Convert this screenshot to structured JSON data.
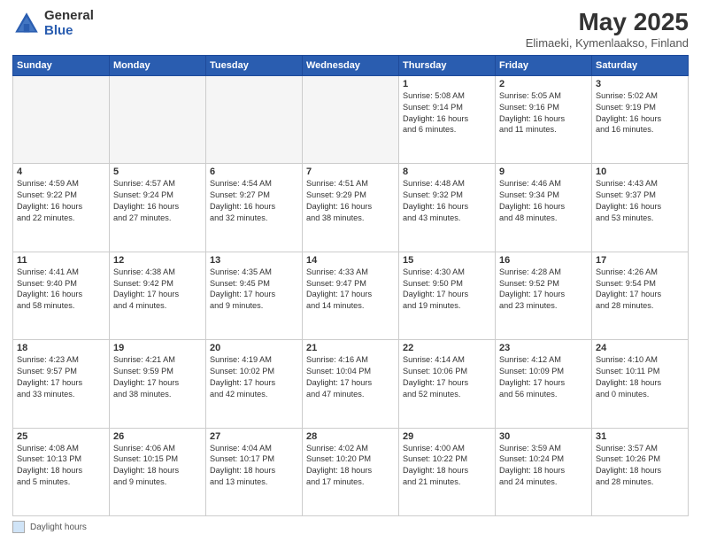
{
  "logo": {
    "general": "General",
    "blue": "Blue"
  },
  "title": "May 2025",
  "subtitle": "Elimaeki, Kymenlaakso, Finland",
  "days_of_week": [
    "Sunday",
    "Monday",
    "Tuesday",
    "Wednesday",
    "Thursday",
    "Friday",
    "Saturday"
  ],
  "footer": {
    "box_label": "Daylight hours"
  },
  "weeks": [
    [
      {
        "num": "",
        "info": ""
      },
      {
        "num": "",
        "info": ""
      },
      {
        "num": "",
        "info": ""
      },
      {
        "num": "",
        "info": ""
      },
      {
        "num": "1",
        "info": "Sunrise: 5:08 AM\nSunset: 9:14 PM\nDaylight: 16 hours\nand 6 minutes."
      },
      {
        "num": "2",
        "info": "Sunrise: 5:05 AM\nSunset: 9:16 PM\nDaylight: 16 hours\nand 11 minutes."
      },
      {
        "num": "3",
        "info": "Sunrise: 5:02 AM\nSunset: 9:19 PM\nDaylight: 16 hours\nand 16 minutes."
      }
    ],
    [
      {
        "num": "4",
        "info": "Sunrise: 4:59 AM\nSunset: 9:22 PM\nDaylight: 16 hours\nand 22 minutes."
      },
      {
        "num": "5",
        "info": "Sunrise: 4:57 AM\nSunset: 9:24 PM\nDaylight: 16 hours\nand 27 minutes."
      },
      {
        "num": "6",
        "info": "Sunrise: 4:54 AM\nSunset: 9:27 PM\nDaylight: 16 hours\nand 32 minutes."
      },
      {
        "num": "7",
        "info": "Sunrise: 4:51 AM\nSunset: 9:29 PM\nDaylight: 16 hours\nand 38 minutes."
      },
      {
        "num": "8",
        "info": "Sunrise: 4:48 AM\nSunset: 9:32 PM\nDaylight: 16 hours\nand 43 minutes."
      },
      {
        "num": "9",
        "info": "Sunrise: 4:46 AM\nSunset: 9:34 PM\nDaylight: 16 hours\nand 48 minutes."
      },
      {
        "num": "10",
        "info": "Sunrise: 4:43 AM\nSunset: 9:37 PM\nDaylight: 16 hours\nand 53 minutes."
      }
    ],
    [
      {
        "num": "11",
        "info": "Sunrise: 4:41 AM\nSunset: 9:40 PM\nDaylight: 16 hours\nand 58 minutes."
      },
      {
        "num": "12",
        "info": "Sunrise: 4:38 AM\nSunset: 9:42 PM\nDaylight: 17 hours\nand 4 minutes."
      },
      {
        "num": "13",
        "info": "Sunrise: 4:35 AM\nSunset: 9:45 PM\nDaylight: 17 hours\nand 9 minutes."
      },
      {
        "num": "14",
        "info": "Sunrise: 4:33 AM\nSunset: 9:47 PM\nDaylight: 17 hours\nand 14 minutes."
      },
      {
        "num": "15",
        "info": "Sunrise: 4:30 AM\nSunset: 9:50 PM\nDaylight: 17 hours\nand 19 minutes."
      },
      {
        "num": "16",
        "info": "Sunrise: 4:28 AM\nSunset: 9:52 PM\nDaylight: 17 hours\nand 23 minutes."
      },
      {
        "num": "17",
        "info": "Sunrise: 4:26 AM\nSunset: 9:54 PM\nDaylight: 17 hours\nand 28 minutes."
      }
    ],
    [
      {
        "num": "18",
        "info": "Sunrise: 4:23 AM\nSunset: 9:57 PM\nDaylight: 17 hours\nand 33 minutes."
      },
      {
        "num": "19",
        "info": "Sunrise: 4:21 AM\nSunset: 9:59 PM\nDaylight: 17 hours\nand 38 minutes."
      },
      {
        "num": "20",
        "info": "Sunrise: 4:19 AM\nSunset: 10:02 PM\nDaylight: 17 hours\nand 42 minutes."
      },
      {
        "num": "21",
        "info": "Sunrise: 4:16 AM\nSunset: 10:04 PM\nDaylight: 17 hours\nand 47 minutes."
      },
      {
        "num": "22",
        "info": "Sunrise: 4:14 AM\nSunset: 10:06 PM\nDaylight: 17 hours\nand 52 minutes."
      },
      {
        "num": "23",
        "info": "Sunrise: 4:12 AM\nSunset: 10:09 PM\nDaylight: 17 hours\nand 56 minutes."
      },
      {
        "num": "24",
        "info": "Sunrise: 4:10 AM\nSunset: 10:11 PM\nDaylight: 18 hours\nand 0 minutes."
      }
    ],
    [
      {
        "num": "25",
        "info": "Sunrise: 4:08 AM\nSunset: 10:13 PM\nDaylight: 18 hours\nand 5 minutes."
      },
      {
        "num": "26",
        "info": "Sunrise: 4:06 AM\nSunset: 10:15 PM\nDaylight: 18 hours\nand 9 minutes."
      },
      {
        "num": "27",
        "info": "Sunrise: 4:04 AM\nSunset: 10:17 PM\nDaylight: 18 hours\nand 13 minutes."
      },
      {
        "num": "28",
        "info": "Sunrise: 4:02 AM\nSunset: 10:20 PM\nDaylight: 18 hours\nand 17 minutes."
      },
      {
        "num": "29",
        "info": "Sunrise: 4:00 AM\nSunset: 10:22 PM\nDaylight: 18 hours\nand 21 minutes."
      },
      {
        "num": "30",
        "info": "Sunrise: 3:59 AM\nSunset: 10:24 PM\nDaylight: 18 hours\nand 24 minutes."
      },
      {
        "num": "31",
        "info": "Sunrise: 3:57 AM\nSunset: 10:26 PM\nDaylight: 18 hours\nand 28 minutes."
      }
    ]
  ]
}
